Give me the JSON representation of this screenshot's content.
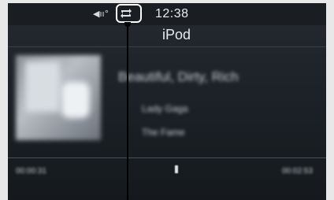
{
  "status_bar": {
    "time": "12:38",
    "volume_icon": "volume-icon",
    "repeat_icon": "repeat-icon"
  },
  "source": {
    "title": "iPod"
  },
  "now_playing": {
    "song_title": "Beautiful, Dirty, Rich",
    "artist": "Lady Gaga",
    "album": "The Fame",
    "elapsed": "00:00:31",
    "remaining": "00:02:53"
  },
  "colors": {
    "screen_bg": "#1d2228",
    "callout": "#ffffff",
    "text": "#e6eaee"
  }
}
